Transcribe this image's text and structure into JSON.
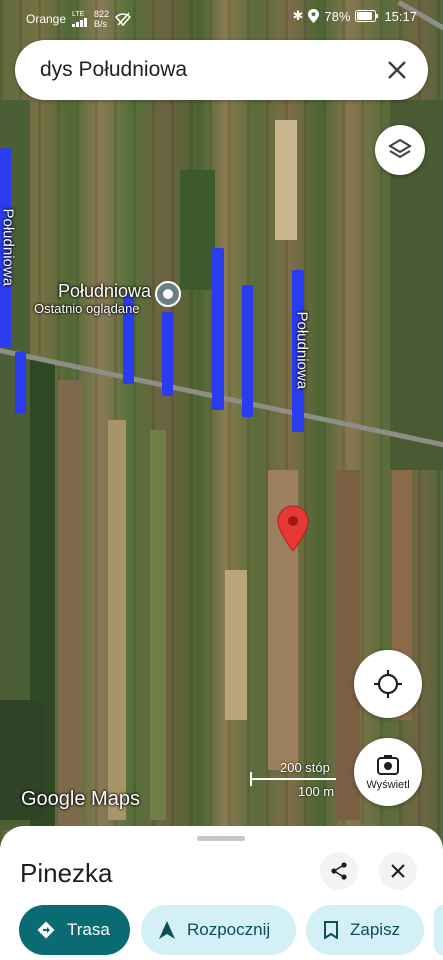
{
  "status_bar": {
    "carrier": "Orange",
    "net_label": "LTE",
    "speed": "822",
    "speed_unit": "B/s",
    "battery": "78%",
    "time": "15:17"
  },
  "search": {
    "query": "dys Południowa"
  },
  "map": {
    "street_labels": {
      "left": "Południowa",
      "right": "Południowa"
    },
    "place": {
      "name": "Południowa",
      "sub": "Ostatnio oglądane"
    },
    "scale": {
      "feet": "200 stóp",
      "meters": "100 m"
    },
    "watermark": "Google Maps",
    "view_button_label": "Wyświetl",
    "highlight_color": "#2a3cf0",
    "pin_color": "#e53935"
  },
  "sheet": {
    "title": "Pinezka",
    "chips": [
      {
        "label": "Trasa",
        "icon": "directions-icon"
      },
      {
        "label": "Rozpocznij",
        "icon": "navigation-arrow-icon"
      },
      {
        "label": "Zapisz",
        "icon": "bookmark-icon"
      }
    ]
  },
  "colors": {
    "primary_chip": "#0b6b73",
    "secondary_chip": "#d3f0f6",
    "secondary_text": "#0b4f58"
  }
}
